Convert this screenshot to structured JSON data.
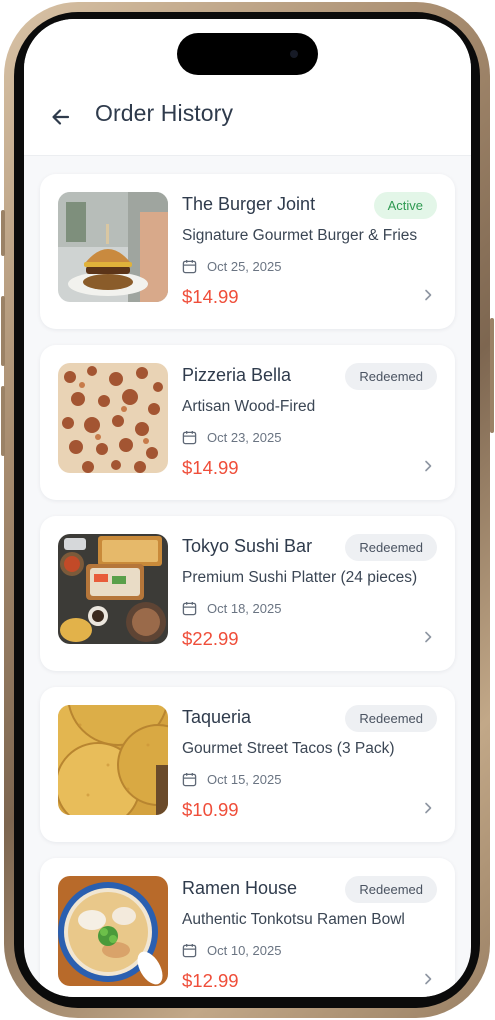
{
  "header": {
    "title": "Order History",
    "back_icon": "arrow-left-icon"
  },
  "orders": [
    {
      "restaurant": "The Burger Joint",
      "item": "Signature Gourmet Burger & Fries",
      "date": "Oct 25, 2025",
      "price": "$14.99",
      "status": "Active",
      "image": "burger-photo"
    },
    {
      "restaurant": "Pizzeria Bella",
      "item": "Artisan Wood-Fired",
      "date": "Oct 23, 2025",
      "price": "$14.99",
      "status": "Redeemed",
      "image": "pizza-photo"
    },
    {
      "restaurant": "Tokyo Sushi Bar",
      "item": "Premium Sushi Platter (24 pieces)",
      "date": "Oct 18, 2025",
      "price": "$22.99",
      "status": "Redeemed",
      "image": "sushi-photo"
    },
    {
      "restaurant": "Taqueria",
      "item": "Gourmet Street Tacos (3 Pack)",
      "date": "Oct 15, 2025",
      "price": "$10.99",
      "status": "Redeemed",
      "image": "tacos-photo"
    },
    {
      "restaurant": "Ramen House",
      "item": "Authentic Tonkotsu Ramen Bowl",
      "date": "Oct 10, 2025",
      "price": "$12.99",
      "status": "Redeemed",
      "image": "ramen-photo"
    }
  ],
  "colors": {
    "price": "#ef4e3a",
    "active_badge_bg": "#e3f6e8",
    "active_badge_text": "#2f9a52",
    "redeemed_badge_bg": "#eef0f3",
    "redeemed_badge_text": "#4a5361",
    "text_primary": "#2f3b4c"
  }
}
